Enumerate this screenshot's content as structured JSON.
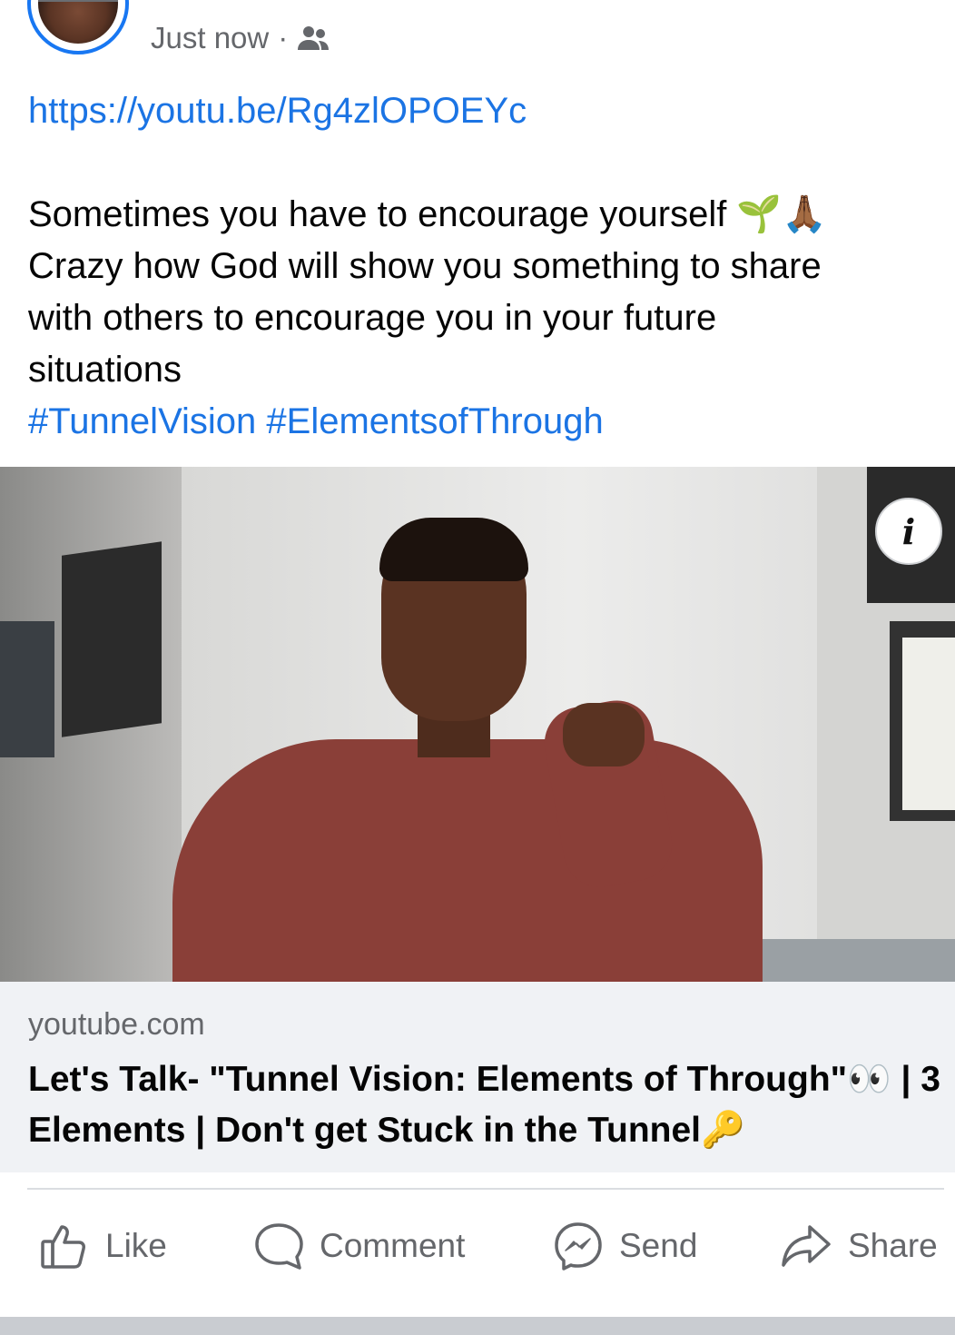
{
  "post": {
    "author": "",
    "timestamp": "Just now",
    "separator": "·",
    "audience_icon": "friends-icon",
    "link": "https://youtu.be/Rg4zlOPOEYc",
    "text_lines": [
      "Sometimes you have to encourage yourself 🌱🙏🏾",
      "Crazy how God will show you something to share",
      "with others to encourage you in your future",
      "situations"
    ],
    "hashtags": "#TunnelVision #ElementsofThrough"
  },
  "link_preview": {
    "domain": "youtube.com",
    "title_lines": [
      "Let's Talk- \"Tunnel Vision: Elements of Through\"👀 | 3",
      "Elements | Don't get Stuck in the Tunnel🔑"
    ],
    "info_label": "i"
  },
  "actions": {
    "like": "Like",
    "comment": "Comment",
    "send": "Send",
    "share": "Share"
  },
  "colors": {
    "accent": "#1b74e4",
    "muted_text": "#65676b",
    "card_bg": "#f0f2f5"
  }
}
